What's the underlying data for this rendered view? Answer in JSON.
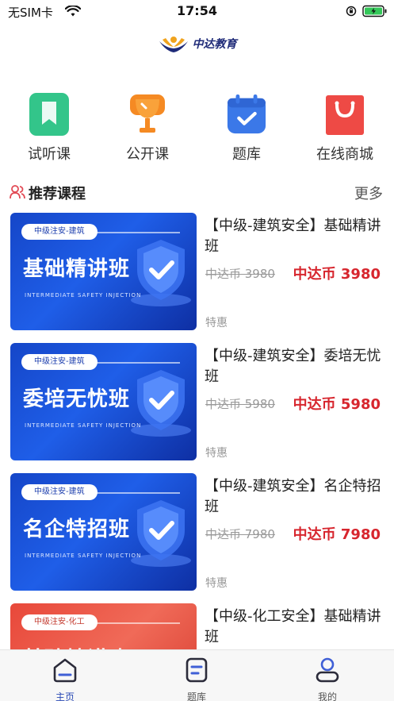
{
  "status_bar": {
    "carrier": "无SIM卡",
    "time": "17:54"
  },
  "header": {
    "logo_text": "中达教育"
  },
  "quick_nav": [
    {
      "label": "试听课",
      "icon": "bookmark-icon",
      "color": "#33c58a"
    },
    {
      "label": "公开课",
      "icon": "trophy-icon",
      "color": "#f58a23"
    },
    {
      "label": "题库",
      "icon": "calendar-check-icon",
      "color": "#3b78e8"
    },
    {
      "label": "在线商城",
      "icon": "shopping-bag-icon",
      "color": "#ee4a45"
    }
  ],
  "section": {
    "title": "推荐课程",
    "more": "更多"
  },
  "courses": [
    {
      "thumb_tag": "中级注安-建筑",
      "thumb_title": "基础精讲班",
      "thumb_sub": "INTERMEDIATE SAFETY INJECTION",
      "title": "【中级-建筑安全】基础精讲班",
      "price_old": "中达币 3980",
      "price_new": "中达币 3980",
      "tag": "特惠"
    },
    {
      "thumb_tag": "中级注安-建筑",
      "thumb_title": "委培无忧班",
      "thumb_sub": "INTERMEDIATE SAFETY INJECTION",
      "title": "【中级-建筑安全】委培无忧班",
      "price_old": "中达币 5980",
      "price_new": "中达币 5980",
      "tag": "特惠"
    },
    {
      "thumb_tag": "中级注安-建筑",
      "thumb_title": "名企特招班",
      "thumb_sub": "INTERMEDIATE SAFETY INJECTION",
      "title": "【中级-建筑安全】名企特招班",
      "price_old": "中达币 7980",
      "price_new": "中达币 7980",
      "tag": "特惠"
    },
    {
      "thumb_tag": "中级注安-化工",
      "thumb_title": "基础精讲班",
      "thumb_sub": "",
      "title": "【中级-化工安全】基础精讲班",
      "price_old": "",
      "price_new": "",
      "tag": ""
    }
  ],
  "tabbar": [
    {
      "label": "主页",
      "icon": "home-icon",
      "active": true
    },
    {
      "label": "题库",
      "icon": "question-bank-icon",
      "active": false
    },
    {
      "label": "我的",
      "icon": "user-icon",
      "active": false
    }
  ],
  "colors": {
    "accent": "#2a4ab5",
    "price": "#d7262e"
  }
}
